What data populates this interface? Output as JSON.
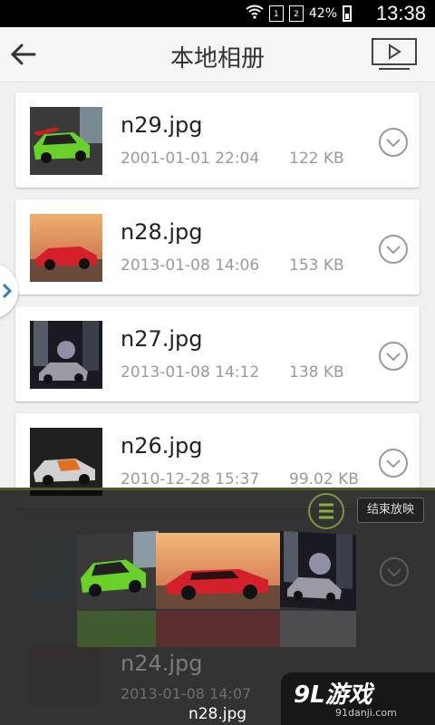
{
  "status_bar": {
    "time": "13:38",
    "battery": "42%",
    "sim1": "1",
    "sim2": "2",
    "icons": [
      "wifi-icon",
      "sim1-icon",
      "sim2-icon",
      "battery-icon"
    ]
  },
  "header": {
    "title": "本地相册",
    "back_icon": "back-arrow-icon",
    "slideshow_icon": "play-slideshow-icon"
  },
  "files": [
    {
      "name": "n29.jpg",
      "date": "2001-01-01 22:04",
      "size": "122 KB"
    },
    {
      "name": "n28.jpg",
      "date": "2013-01-08 14:06",
      "size": "153 KB"
    },
    {
      "name": "n27.jpg",
      "date": "2013-01-08 14:12",
      "size": "138 KB"
    },
    {
      "name": "n26.jpg",
      "date": "2010-12-28 15:37",
      "size": "99.02 KB"
    }
  ],
  "faded_file": {
    "name": "n24.jpg",
    "date": "2013-01-08 14:07"
  },
  "slideshow_overlay": {
    "end_label": "结束放映",
    "current_caption": "n28.jpg",
    "menu_icon": "menu-icon"
  },
  "watermark": {
    "logo": "9L游戏",
    "url": "91danji.com"
  },
  "colors": {
    "accent_green": "#7a9a3a",
    "header_bg": "#f5f5f5",
    "list_bg": "#f0f0f0"
  }
}
